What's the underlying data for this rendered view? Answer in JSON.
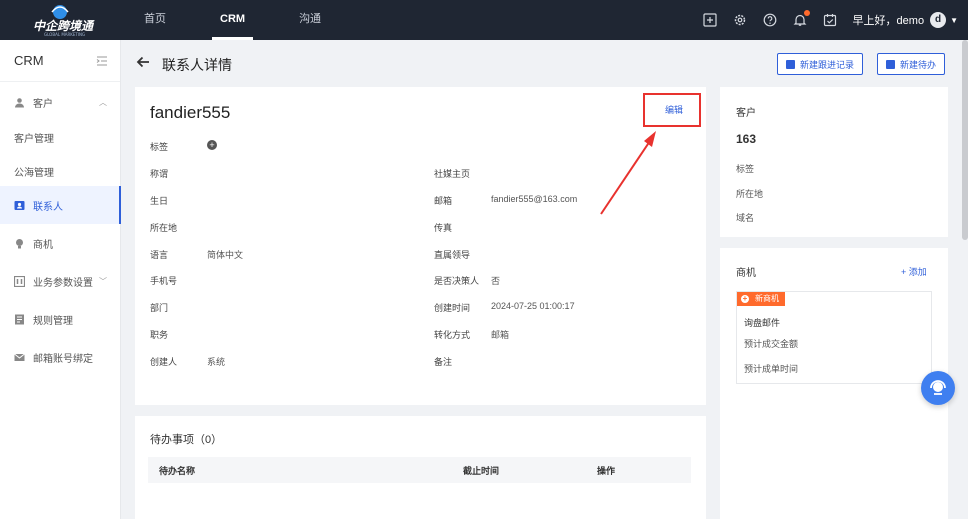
{
  "topbar": {
    "logo_text": "中企跨境通",
    "logo_sub": "GLOBAL MARKETING",
    "nav": [
      {
        "label": "首页"
      },
      {
        "label": "CRM"
      },
      {
        "label": "沟通"
      }
    ],
    "greeting": "早上好，demo",
    "avatar_letter": "d"
  },
  "sidebar": {
    "title": "CRM",
    "items": [
      {
        "label": "客户"
      },
      {
        "label": "客户管理"
      },
      {
        "label": "公海管理"
      },
      {
        "label": "联系人"
      },
      {
        "label": "商机"
      },
      {
        "label": "业务参数设置"
      },
      {
        "label": "规则管理"
      },
      {
        "label": "邮箱账号绑定"
      }
    ]
  },
  "header": {
    "title": "联系人详情",
    "btn_follow": "新建跟进记录",
    "btn_todo": "新建待办"
  },
  "contact": {
    "name": "fandier555",
    "edit": "编辑",
    "tag_label": "标签",
    "left_fields": [
      {
        "label": "称谓",
        "value": ""
      },
      {
        "label": "生日",
        "value": ""
      },
      {
        "label": "所在地",
        "value": ""
      },
      {
        "label": "语言",
        "value": "简体中文"
      },
      {
        "label": "手机号",
        "value": ""
      },
      {
        "label": "部门",
        "value": ""
      },
      {
        "label": "职务",
        "value": ""
      },
      {
        "label": "创建人",
        "value": "系统"
      }
    ],
    "right_fields": [
      {
        "label": "社媒主页",
        "value": ""
      },
      {
        "label": "邮箱",
        "value": "fandier555@163.com"
      },
      {
        "label": "传真",
        "value": ""
      },
      {
        "label": "直属领导",
        "value": ""
      },
      {
        "label": "是否决策人",
        "value": "否"
      },
      {
        "label": "创建时间",
        "value": "2024-07-25 01:00:17"
      },
      {
        "label": "转化方式",
        "value": "邮箱"
      },
      {
        "label": "备注",
        "value": ""
      }
    ]
  },
  "todo": {
    "title": "待办事项（0）",
    "columns": [
      "待办名称",
      "截止时间",
      "操作"
    ]
  },
  "customer_panel": {
    "title": "客户",
    "name": "163",
    "fields": [
      "标签",
      "所在地",
      "域名"
    ]
  },
  "opportunity_panel": {
    "title": "商机",
    "add": "+ 添加",
    "tag": "新商机",
    "opp_name": "询盘邮件",
    "fields": [
      "预计成交金额",
      "预计成单时间"
    ]
  },
  "colors": {
    "topbar": "#1f2633",
    "accent": "#2f5fd9",
    "orange": "#ff6a2c",
    "annotation_red": "#e8322e"
  }
}
